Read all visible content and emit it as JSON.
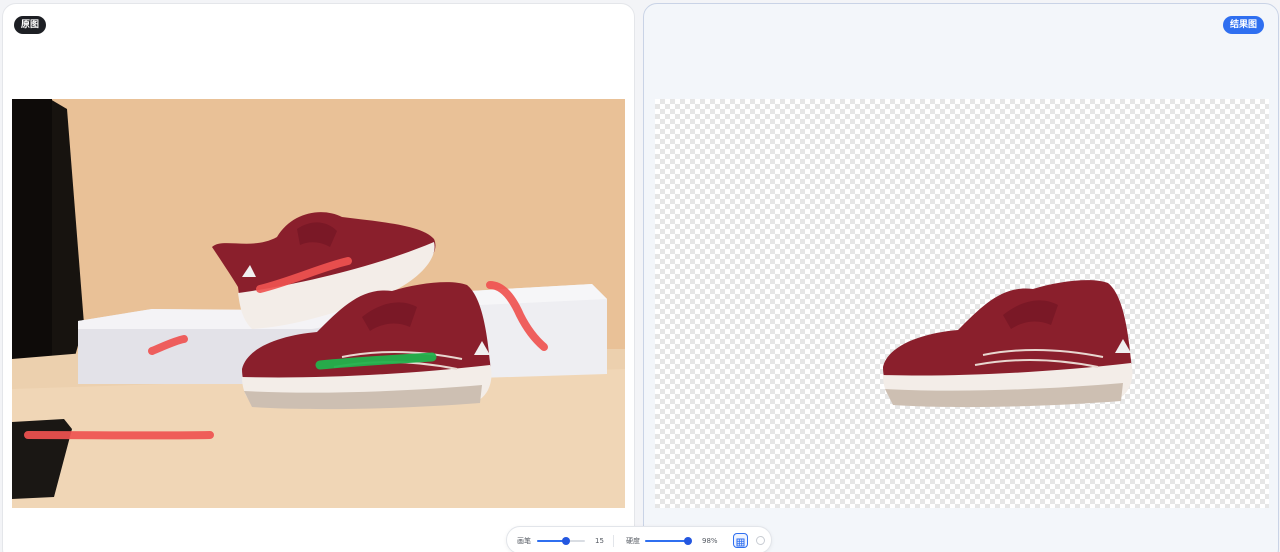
{
  "panels": {
    "original_label": "原图",
    "result_label": "结果图"
  },
  "toolbar": {
    "brush_label": "画笔",
    "brush_value": "15",
    "brush_level": 0.6,
    "hardness_label": "硬度",
    "hardness_value": "98%",
    "hardness_level": 0.98,
    "grid_toggle_icon": "grid-icon",
    "circle_toggle_icon": "circle-icon"
  },
  "colors": {
    "accent": "#2f6ff0",
    "remove_stroke": "#ef5350",
    "keep_stroke": "#22b24c",
    "shoe": "#8a1f2c"
  }
}
